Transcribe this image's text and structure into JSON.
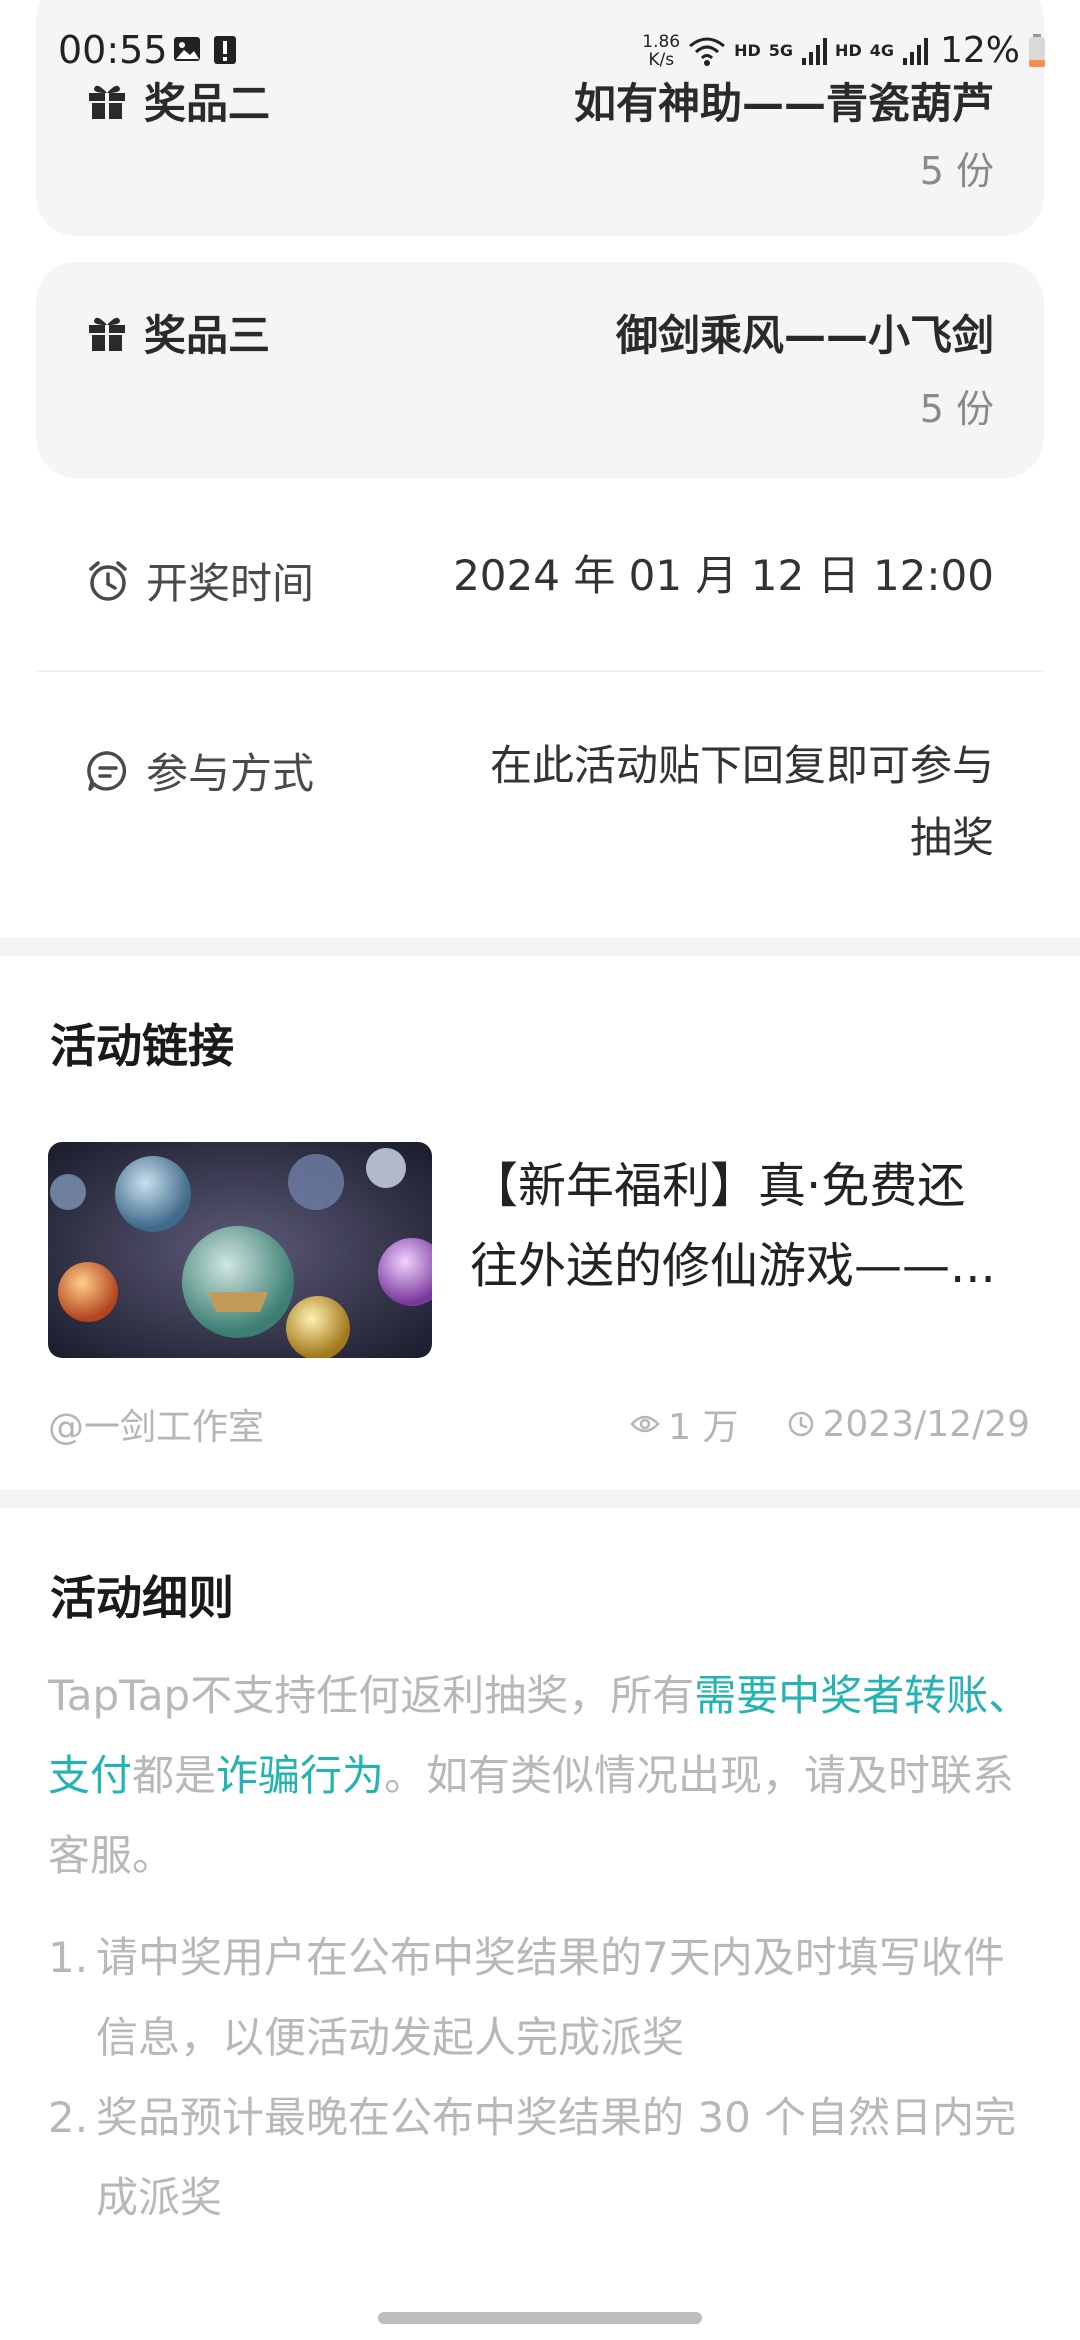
{
  "status_bar": {
    "time": "00:55",
    "speed_value": "1.86",
    "speed_unit": "K/s",
    "hd1": "HD",
    "net1": "5G",
    "hd2": "HD",
    "net2": "4G",
    "battery": "12%"
  },
  "prizes": [
    {
      "label": "奖品二",
      "title": "如有神助——青瓷葫芦",
      "quantity": "5 份"
    },
    {
      "label": "奖品三",
      "title": "御剑乘风——小飞剑",
      "quantity": "5 份"
    }
  ],
  "draw_time": {
    "label": "开奖时间",
    "value": "2024 年 01 月 12 日 12:00"
  },
  "participation": {
    "label": "参与方式",
    "value_line1": "在此活动贴下回复即可参与",
    "value_line2": "抽奖"
  },
  "activity_link": {
    "section_title": "活动链接",
    "title_line1": "【新年福利】真·免费还",
    "title_line2": "往外送的修仙游戏——...",
    "author": "@一剑工作室",
    "views": "1 万",
    "date": "2023/12/29"
  },
  "rules": {
    "section_title": "活动细则",
    "para_part1": "TapTap不支持任何返利抽奖，所有",
    "para_hl1": "需要中奖者转账、支付",
    "para_part2": "都是",
    "para_hl2": "诈骗行为",
    "para_part3": "。如有类似情况出现，请及时联系客服。",
    "items": [
      {
        "num": "1.",
        "text": "请中奖用户在公布中奖结果的7天内及时填写收件信息，以便活动发起人完成派奖"
      },
      {
        "num": "2.",
        "text": "奖品预计最晚在公布中奖结果的 30 个自然日内完成派奖"
      }
    ]
  },
  "colors": {
    "accent": "#23b3b3",
    "card_bg": "#f4f5f7",
    "muted_text": "#b8b8b8"
  }
}
